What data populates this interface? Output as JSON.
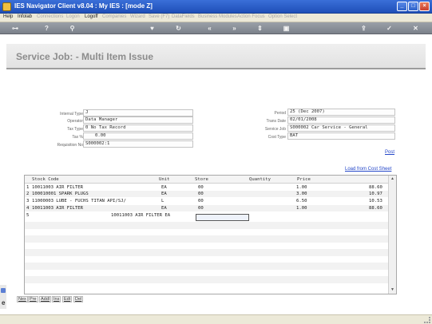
{
  "window": {
    "title": "IES Navigator Client v8.04 : My IES :      [mode Z]",
    "minimize": "_",
    "maximize": "□",
    "close": "×"
  },
  "menu": [
    "Help",
    "Infolab",
    "Connections",
    "Logon",
    "Logoff",
    "Companies",
    "Wizard",
    "Save (F7)",
    "DataFields",
    "Business Modules",
    "Action Focus",
    "Option Select"
  ],
  "toolbar_icons": [
    "key-icon",
    "info-icon",
    "search-icon",
    "heart-icon",
    "refresh-icon",
    "rewind-icon",
    "fast-forward-icon",
    "expand-icon",
    "print-icon",
    "upload-icon",
    "check-icon",
    "close-icon"
  ],
  "page": {
    "title": "Service Job: - Multi Item Issue"
  },
  "form": {
    "internal_type_label": "Internal Type",
    "internal_type": "J",
    "operator_label": "Operator",
    "operator": "Data Manager",
    "tax_type_label": "Tax Type",
    "tax_type": "0 No Tax Record",
    "tax_pct_label": "Tax %",
    "tax_pct": "0.00",
    "requisition_label": "Requisition No",
    "requisition": "S000002:1",
    "period_label": "Period",
    "period": "25 (Dec 2007)",
    "trans_date_label": "Trans Date",
    "trans_date": "02/01/2008",
    "service_job_label": "Service Job",
    "service_job": "S000002 Car Service - General",
    "cost_type_label": "Cost Type",
    "cost_type": "BAT"
  },
  "links": {
    "post": "Post",
    "load_from_cost_sheet": "Load from Cost Sheet"
  },
  "grid": {
    "columns": {
      "stock_code": "Stock Code",
      "unit": "Unit",
      "store": "Store",
      "quantity": "Quantity",
      "price": "Price"
    },
    "rows": [
      {
        "n": "1",
        "stock": "10011003 AIR FILTER",
        "unit": "EA",
        "store": "00",
        "qty": "1.00",
        "price": "88.60"
      },
      {
        "n": "2",
        "stock": "100010001 SPARK PLUGS",
        "unit": "EA",
        "store": "00",
        "qty": "3.00",
        "price": "10.97"
      },
      {
        "n": "3",
        "stock": "11000003 LUBE - FUCHS TITAN API/SJ/",
        "unit": "L",
        "store": "00",
        "qty": "6.50",
        "price": "10.53"
      },
      {
        "n": "4",
        "stock": "10011003 AIR FILTER",
        "unit": "EA",
        "store": "00",
        "qty": "1.00",
        "price": "88.60"
      },
      {
        "n": "5",
        "stock": "10011003 AIR FILTER EA",
        "unit": "",
        "store": "",
        "qty": "",
        "price": ""
      }
    ]
  },
  "nav": [
    "Nex",
    "Pre",
    "Addl",
    "Ins",
    "Edt",
    "Del"
  ]
}
